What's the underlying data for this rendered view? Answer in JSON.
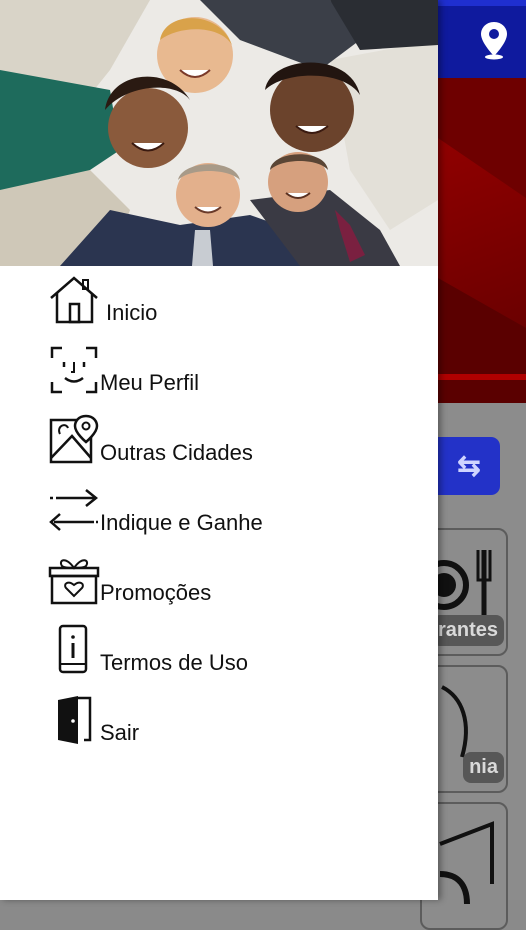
{
  "app": {
    "header_icon": "location-pin-icon",
    "action_button_glyph": "⇆",
    "tiles": [
      {
        "label": "rantes",
        "icon": "plate-cutlery-icon"
      },
      {
        "label": "nia",
        "icon": "outline-icon"
      },
      {
        "label": "",
        "icon": "display-icon"
      }
    ],
    "colors": {
      "header": "#0f1a9e",
      "banner": "#8e0000",
      "button": "#2332c8"
    }
  },
  "drawer": {
    "hero_image": "group-of-smiling-people-photo",
    "menu": [
      {
        "label": "Inicio",
        "icon": "house-icon"
      },
      {
        "label": "Meu Perfil",
        "icon": "face-scan-icon"
      },
      {
        "label": "Outras Cidades",
        "icon": "map-pin-icon"
      },
      {
        "label": "Indique e Ganhe",
        "icon": "arrows-exchange-icon"
      },
      {
        "label": "Promoções",
        "icon": "gift-box-icon"
      },
      {
        "label": "Termos de Uso",
        "icon": "phone-info-icon"
      },
      {
        "label": "Sair",
        "icon": "exit-door-icon"
      }
    ]
  }
}
